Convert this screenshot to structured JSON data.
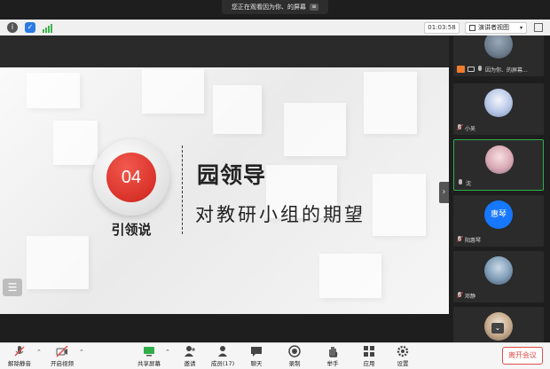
{
  "banner": {
    "text": "您正在观看因为你、的屏幕",
    "menu_icon": "hamburger-icon"
  },
  "topbar": {
    "timer": "01:03:58",
    "view_label": "演讲者视图",
    "icons": [
      "info-icon",
      "shield-icon",
      "signal-icon",
      "fullscreen-icon"
    ]
  },
  "slide": {
    "number": "04",
    "badge_label": "引领说",
    "title": "园领导",
    "subtitle": "对教研小组的期望"
  },
  "participants": [
    {
      "name": "因为你、的屏幕...",
      "kind": "photo",
      "host": true,
      "active": false
    },
    {
      "name": "小吴",
      "kind": "photo",
      "host": false,
      "active": false
    },
    {
      "name": "沈",
      "kind": "photo",
      "host": false,
      "active": true
    },
    {
      "name": "阳惠琴",
      "kind": "initials",
      "initials": "惠琴",
      "host": false,
      "active": false
    },
    {
      "name": "邓静",
      "kind": "photo",
      "host": false,
      "active": false
    },
    {
      "name": "",
      "kind": "photo",
      "host": false,
      "active": false
    }
  ],
  "toolbar": {
    "mute": "解除静音",
    "video": "开启视频",
    "share": "共享屏幕",
    "invite": "邀请",
    "members": "成员(17)",
    "chat": "聊天",
    "record": "录制",
    "raise_hand": "举手",
    "apps": "应用",
    "settings": "设置",
    "leave": "离开会议"
  },
  "colors": {
    "accent_red": "#d9332a",
    "active_green": "#2fae4a",
    "leave_red": "#e24b4b",
    "initials_blue": "#1677ff"
  }
}
